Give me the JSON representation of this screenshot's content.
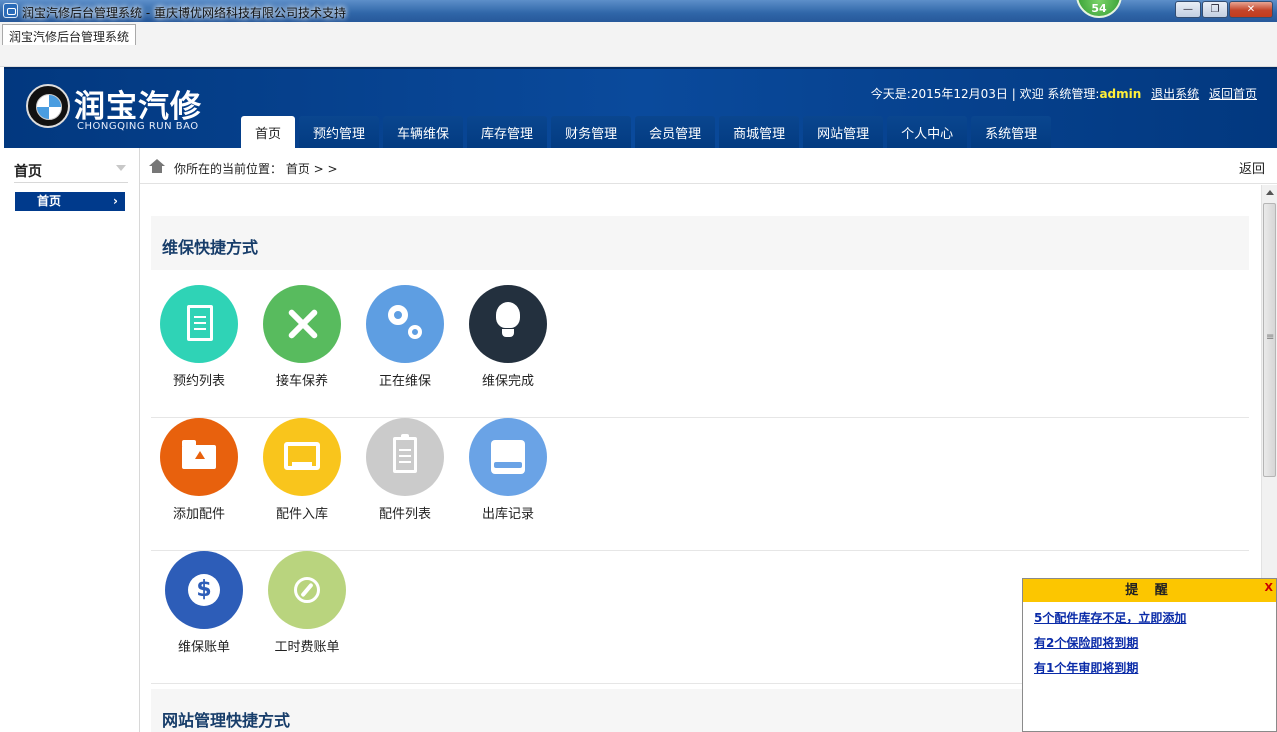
{
  "window": {
    "title": "润宝汽修后台管理系统 - 重庆博优网络科技有限公司技术支持",
    "badge": "54",
    "minimize": "—",
    "maximize": "❐",
    "close": "✕"
  },
  "browser": {
    "tab": "润宝汽修后台管理系统"
  },
  "header": {
    "logo_cn": "润宝汽修",
    "logo_en": "CHONGQING RUN BAO",
    "date_text": "今天是:2015年12月03日 | 欢迎 系统管理:",
    "admin": "admin",
    "logout": "退出系统",
    "home_link": "返回首页"
  },
  "nav": [
    "首页",
    "预约管理",
    "车辆维保",
    "库存管理",
    "财务管理",
    "会员管理",
    "商城管理",
    "网站管理",
    "个人中心",
    "系统管理"
  ],
  "sidebar": {
    "title": "首页",
    "item": "首页"
  },
  "breadcrumb": {
    "text": "你所在的当前位置： 首页 > >",
    "back": "返回"
  },
  "sections": {
    "maint": "维保快捷方式",
    "site": "网站管理快捷方式"
  },
  "shortcuts": {
    "row1": [
      {
        "label": "预约列表",
        "color": "#2fd3b6"
      },
      {
        "label": "接车保养",
        "color": "#58bb5e"
      },
      {
        "label": "正在维保",
        "color": "#5e9ee2"
      },
      {
        "label": "维保完成",
        "color": "#23303e"
      }
    ],
    "row2": [
      {
        "label": "添加配件",
        "color": "#e8610d"
      },
      {
        "label": "配件入库",
        "color": "#f9c51c"
      },
      {
        "label": "配件列表",
        "color": "#cbcbcb"
      },
      {
        "label": "出库记录",
        "color": "#6aa3e6"
      }
    ],
    "row3": [
      {
        "label": "维保账单",
        "color": "#2d5db8"
      },
      {
        "label": "工时费账单",
        "color": "#b9d47e"
      }
    ]
  },
  "reminder": {
    "title": "提 醒",
    "close": "X",
    "links": [
      "5个配件库存不足，立即添加",
      "有2个保险即将到期",
      "有1个年审即将到期"
    ]
  }
}
